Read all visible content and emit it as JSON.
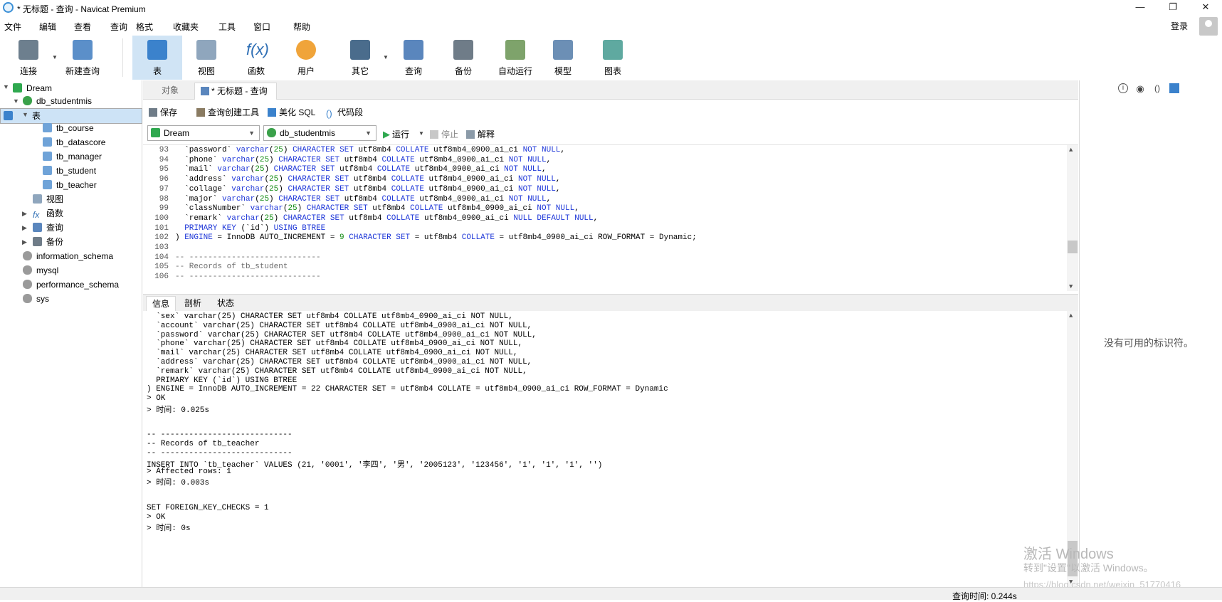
{
  "window": {
    "title": "* 无标题 - 查询 - Navicat Premium",
    "minimize": "—",
    "maximize": "❐",
    "close": "✕"
  },
  "menu": [
    "文件",
    "编辑",
    "查看",
    "查询",
    "格式",
    "收藏夹",
    "工具",
    "窗口",
    "帮助"
  ],
  "account": {
    "login_label": "登录"
  },
  "toolbar": [
    {
      "label": "连接",
      "icon": "plug-icon"
    },
    {
      "label": "新建查询",
      "icon": "new-query-icon"
    },
    {
      "label": "表",
      "icon": "table-icon"
    },
    {
      "label": "视图",
      "icon": "view-icon"
    },
    {
      "label": "函数",
      "icon": "function-icon"
    },
    {
      "label": "用户",
      "icon": "user-icon"
    },
    {
      "label": "其它",
      "icon": "tools-icon"
    },
    {
      "label": "查询",
      "icon": "query-icon"
    },
    {
      "label": "备份",
      "icon": "backup-icon"
    },
    {
      "label": "自动运行",
      "icon": "schedule-icon"
    },
    {
      "label": "模型",
      "icon": "model-icon"
    },
    {
      "label": "图表",
      "icon": "chart-icon"
    }
  ],
  "sidebar": {
    "connection": "Dream",
    "database": "db_studentmis",
    "tables_group": "表",
    "tables": [
      "tb_course",
      "tb_datascore",
      "tb_manager",
      "tb_student",
      "tb_teacher"
    ],
    "groups": [
      "视图",
      "函数",
      "查询",
      "备份"
    ],
    "other_dbs": [
      "information_schema",
      "mysql",
      "performance_schema",
      "sys"
    ]
  },
  "tabs": {
    "objects": "对象",
    "query": "* 无标题 - 查询"
  },
  "query_toolbar": {
    "save": "保存",
    "builder": "查询创建工具",
    "beautify": "美化 SQL",
    "snippet": "代码段",
    "run": "运行",
    "stop": "停止",
    "explain": "解释"
  },
  "selectors": {
    "connection": "Dream",
    "database": "db_studentmis"
  },
  "editor": {
    "lines": [
      {
        "n": "93",
        "t": "  `password` varchar(25) CHARACTER SET utf8mb4 COLLATE utf8mb4_0900_ai_ci NOT NULL,"
      },
      {
        "n": "94",
        "t": "  `phone` varchar(25) CHARACTER SET utf8mb4 COLLATE utf8mb4_0900_ai_ci NOT NULL,"
      },
      {
        "n": "95",
        "t": "  `mail` varchar(25) CHARACTER SET utf8mb4 COLLATE utf8mb4_0900_ai_ci NOT NULL,"
      },
      {
        "n": "96",
        "t": "  `address` varchar(25) CHARACTER SET utf8mb4 COLLATE utf8mb4_0900_ai_ci NOT NULL,"
      },
      {
        "n": "97",
        "t": "  `collage` varchar(25) CHARACTER SET utf8mb4 COLLATE utf8mb4_0900_ai_ci NOT NULL,"
      },
      {
        "n": "98",
        "t": "  `major` varchar(25) CHARACTER SET utf8mb4 COLLATE utf8mb4_0900_ai_ci NOT NULL,"
      },
      {
        "n": "99",
        "t": "  `classNumber` varchar(25) CHARACTER SET utf8mb4 COLLATE utf8mb4_0900_ai_ci NOT NULL,"
      },
      {
        "n": "100",
        "t": "  `remark` varchar(25) CHARACTER SET utf8mb4 COLLATE utf8mb4_0900_ai_ci NULL DEFAULT NULL,"
      },
      {
        "n": "101",
        "t": "  PRIMARY KEY (`id`) USING BTREE"
      },
      {
        "n": "102",
        "t": ") ENGINE = InnoDB AUTO_INCREMENT = 9 CHARACTER SET = utf8mb4 COLLATE = utf8mb4_0900_ai_ci ROW_FORMAT = Dynamic;"
      },
      {
        "n": "103",
        "t": ""
      },
      {
        "n": "104",
        "t": "-- ----------------------------"
      },
      {
        "n": "105",
        "t": "-- Records of tb_student"
      },
      {
        "n": "106",
        "t": "-- ----------------------------"
      }
    ]
  },
  "result_tabs": [
    "信息",
    "剖析",
    "状态"
  ],
  "results": [
    "  `sex` varchar(25) CHARACTER SET utf8mb4 COLLATE utf8mb4_0900_ai_ci NOT NULL,",
    "  `account` varchar(25) CHARACTER SET utf8mb4 COLLATE utf8mb4_0900_ai_ci NOT NULL,",
    "  `password` varchar(25) CHARACTER SET utf8mb4 COLLATE utf8mb4_0900_ai_ci NOT NULL,",
    "  `phone` varchar(25) CHARACTER SET utf8mb4 COLLATE utf8mb4_0900_ai_ci NOT NULL,",
    "  `mail` varchar(25) CHARACTER SET utf8mb4 COLLATE utf8mb4_0900_ai_ci NOT NULL,",
    "  `address` varchar(25) CHARACTER SET utf8mb4 COLLATE utf8mb4_0900_ai_ci NOT NULL,",
    "  `remark` varchar(25) CHARACTER SET utf8mb4 COLLATE utf8mb4_0900_ai_ci NOT NULL,",
    "  PRIMARY KEY (`id`) USING BTREE",
    ") ENGINE = InnoDB AUTO_INCREMENT = 22 CHARACTER SET = utf8mb4 COLLATE = utf8mb4_0900_ai_ci ROW_FORMAT = Dynamic",
    "> OK",
    "> 时间: 0.025s",
    "",
    "",
    "-- ----------------------------",
    "-- Records of tb_teacher",
    "-- ----------------------------",
    "INSERT INTO `tb_teacher` VALUES (21, '0001', '李四', '男', '2005123', '123456', '1', '1', '1', '')",
    "> Affected rows: 1",
    "> 时间: 0.003s",
    "",
    "",
    "SET FOREIGN_KEY_CHECKS = 1",
    "> OK",
    "> 时间: 0s"
  ],
  "right_panel": {
    "empty_text": "没有可用的标识符。"
  },
  "watermark": {
    "line1": "激活 Windows",
    "line2": "转到\"设置\"以激活 Windows。",
    "line3": "https://blog.csdn.net/weixin_51770416"
  },
  "status": {
    "query_time": "查询时间: 0.244s"
  },
  "colors": {
    "keyword": "#1e37d8",
    "number": "#0e8a0e",
    "comment": "#6b6b6b",
    "selection": "#cde3f6"
  }
}
